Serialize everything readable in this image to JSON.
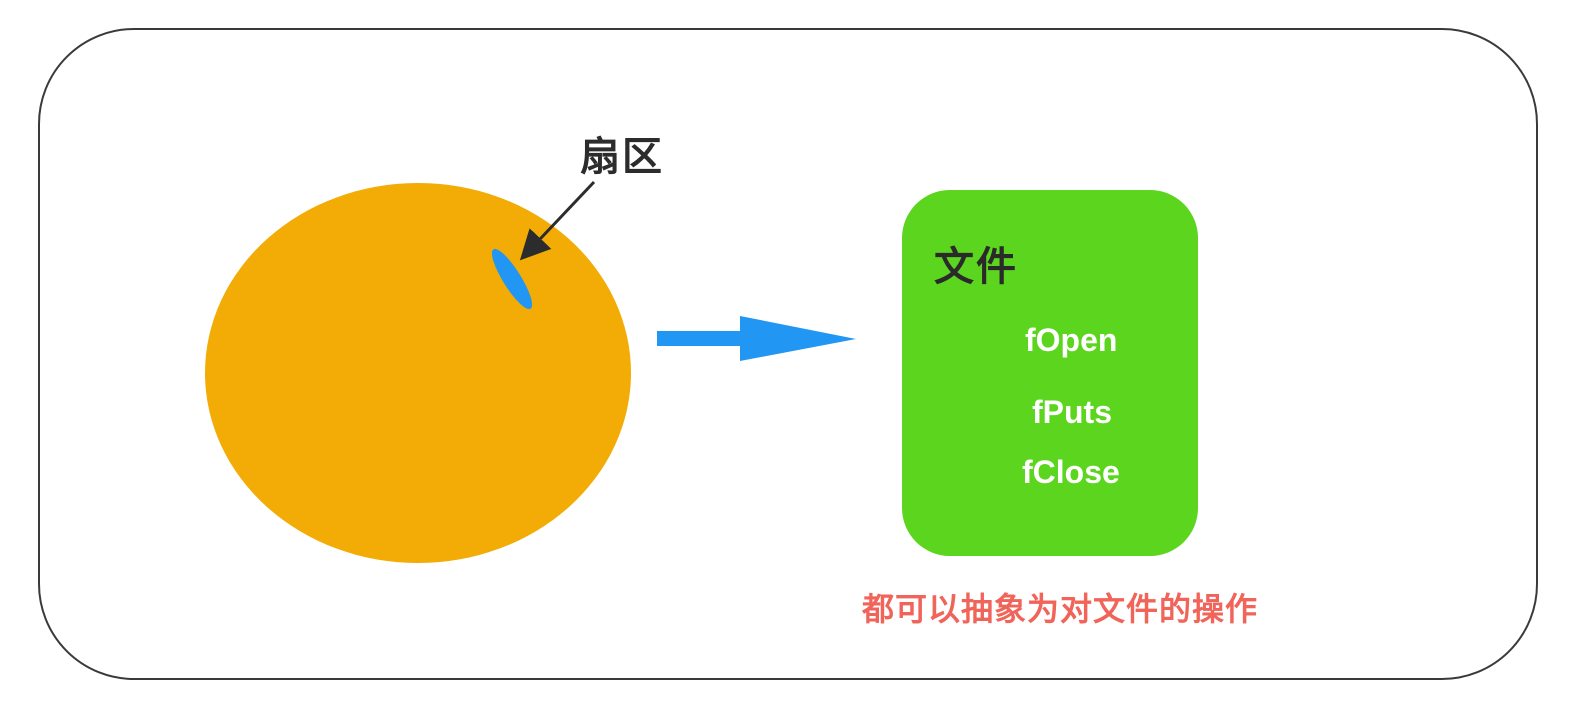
{
  "sector_label": "扇区",
  "file_box": {
    "title": "文件",
    "operations": [
      "fOpen",
      "fPuts",
      "fClose"
    ]
  },
  "caption": "都可以抽象为对文件的操作",
  "colors": {
    "disk": "#f2ac05",
    "sector": "#2196f3",
    "arrow": "#2196f3",
    "file_box": "#5cd51e",
    "caption": "#f0645a",
    "pointer": "#2c2c2c"
  }
}
